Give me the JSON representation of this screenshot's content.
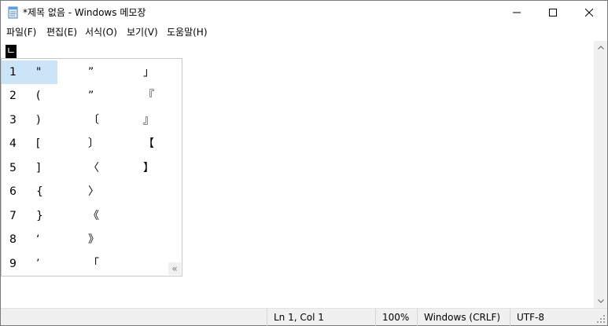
{
  "window": {
    "title": "*제목 없음 - Windows 메모장"
  },
  "menu": {
    "items": [
      "파일(F)",
      "편집(E)",
      "서식(O)",
      "보기(V)",
      "도움말(H)"
    ]
  },
  "editor": {
    "composing_char": "ㄴ"
  },
  "candidates": {
    "rows": [
      {
        "num": "1",
        "c1": "\"",
        "c2": "”",
        "c3": "」"
      },
      {
        "num": "2",
        "c1": "(",
        "c2": "”",
        "c3": "『"
      },
      {
        "num": "3",
        "c1": ")",
        "c2": "〔",
        "c3": "』"
      },
      {
        "num": "4",
        "c1": "[",
        "c2": "〕",
        "c3": "【"
      },
      {
        "num": "5",
        "c1": "]",
        "c2": "〈",
        "c3": "】"
      },
      {
        "num": "6",
        "c1": "{",
        "c2": "〉",
        "c3": ""
      },
      {
        "num": "7",
        "c1": "}",
        "c2": "《",
        "c3": ""
      },
      {
        "num": "8",
        "c1": "‘",
        "c2": "》",
        "c3": ""
      },
      {
        "num": "9",
        "c1": "’",
        "c2": "「",
        "c3": ""
      }
    ],
    "expand_glyph": "«"
  },
  "status": {
    "position": "Ln 1, Col 1",
    "zoom": "100%",
    "line_ending": "Windows (CRLF)",
    "encoding": "UTF-8"
  },
  "colors": {
    "selection": "#cce4f7",
    "statusbar": "#f0f0f0"
  }
}
